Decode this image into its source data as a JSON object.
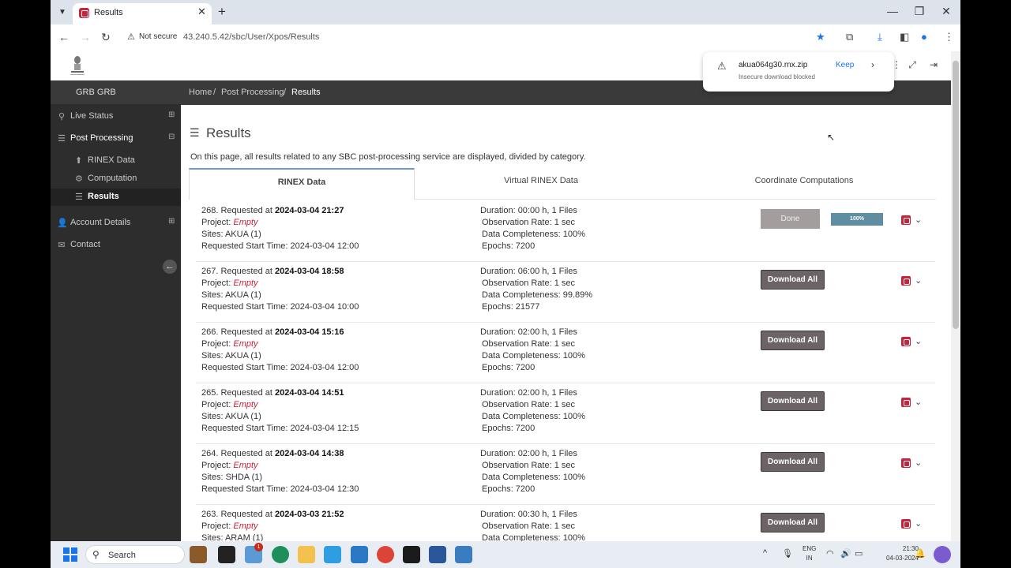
{
  "browser": {
    "tab_title": "Results",
    "tab_close": "✕",
    "new_tab": "+",
    "security_label": "Not secure",
    "url": "43.240.5.42/sbc/User/Xpos/Results"
  },
  "download": {
    "filename": "akua064g30.rnx.zip",
    "message": "Insecure download blocked",
    "keep_label": "Keep"
  },
  "sidebar": {
    "user": "GRB GRB",
    "items": [
      {
        "label": "Live Status",
        "icon": "map-pin-icon"
      },
      {
        "label": "Post Processing",
        "icon": "database-icon"
      },
      {
        "label": "Account Details",
        "icon": "user-icon"
      },
      {
        "label": "Contact",
        "icon": "mail-icon"
      }
    ],
    "sub_items": [
      {
        "label": "RINEX Data",
        "icon": "upload-icon"
      },
      {
        "label": "Computation",
        "icon": "gear-icon"
      },
      {
        "label": "Results",
        "icon": "list-icon"
      }
    ]
  },
  "breadcrumb": {
    "items": [
      "Home",
      "Post Processing",
      "Results"
    ],
    "separator": "/"
  },
  "page": {
    "title": "Results",
    "description": "On this page, all results related to any SBC post-processing service are displayed, divided by category.",
    "tabs": [
      "RINEX Data",
      "Virtual RINEX Data",
      "Coordinate Computations"
    ]
  },
  "labels": {
    "requested_at": "Requested at",
    "project": "Project:",
    "sites": "Sites:",
    "start_time": "Requested Start Time:",
    "download_all": "Download All",
    "done": "Done"
  },
  "results": [
    {
      "id": "268.",
      "requested": "2024-03-04 21:27",
      "project": "Empty",
      "sites": "AKUA (1)",
      "start": "2024-03-04 12:00",
      "duration": "Duration: 00:00 h, 1 Files",
      "rate": "Observation Rate: 1 sec",
      "completeness": "Data Completeness: 100%",
      "epochs": "Epochs: 7200",
      "status": "done",
      "progress": "100%"
    },
    {
      "id": "267.",
      "requested": "2024-03-04 18:58",
      "project": "Empty",
      "sites": "AKUA (1)",
      "start": "2024-03-04 10:00",
      "duration": "Duration: 06:00 h, 1 Files",
      "rate": "Observation Rate: 1 sec",
      "completeness": "Data Completeness: 99.89%",
      "epochs": "Epochs: 21577",
      "status": "download"
    },
    {
      "id": "266.",
      "requested": "2024-03-04 15:16",
      "project": "Empty",
      "sites": "AKUA (1)",
      "start": "2024-03-04 12:00",
      "duration": "Duration: 02:00 h, 1 Files",
      "rate": "Observation Rate: 1 sec",
      "completeness": "Data Completeness: 100%",
      "epochs": "Epochs: 7200",
      "status": "download"
    },
    {
      "id": "265.",
      "requested": "2024-03-04 14:51",
      "project": "Empty",
      "sites": "AKUA (1)",
      "start": "2024-03-04 12:15",
      "duration": "Duration: 02:00 h, 1 Files",
      "rate": "Observation Rate: 1 sec",
      "completeness": "Data Completeness: 100%",
      "epochs": "Epochs: 7200",
      "status": "download"
    },
    {
      "id": "264.",
      "requested": "2024-03-04 14:38",
      "project": "Empty",
      "sites": "SHDA (1)",
      "start": "2024-03-04 12:30",
      "duration": "Duration: 02:00 h, 1 Files",
      "rate": "Observation Rate: 1 sec",
      "completeness": "Data Completeness: 100%",
      "epochs": "Epochs: 7200",
      "status": "download"
    },
    {
      "id": "263.",
      "requested": "2024-03-03 21:52",
      "project": "Empty",
      "sites": "ARAM (1)",
      "start": "",
      "duration": "Duration: 00:30 h, 1 Files",
      "rate": "Observation Rate: 1 sec",
      "completeness": "Data Completeness: 100%",
      "epochs": "",
      "status": "download"
    }
  ],
  "taskbar": {
    "search_label": "Search",
    "notification_count": "1",
    "lang_line1": "ENG",
    "lang_line2": "IN",
    "time": "21:30",
    "date": "04-03-2024"
  },
  "colors": {
    "brand_red": "#c8233b",
    "sidebar_bg": "#2d2d2d",
    "button_bg": "#6b6365",
    "progress_bg": "#5f8ea3"
  }
}
